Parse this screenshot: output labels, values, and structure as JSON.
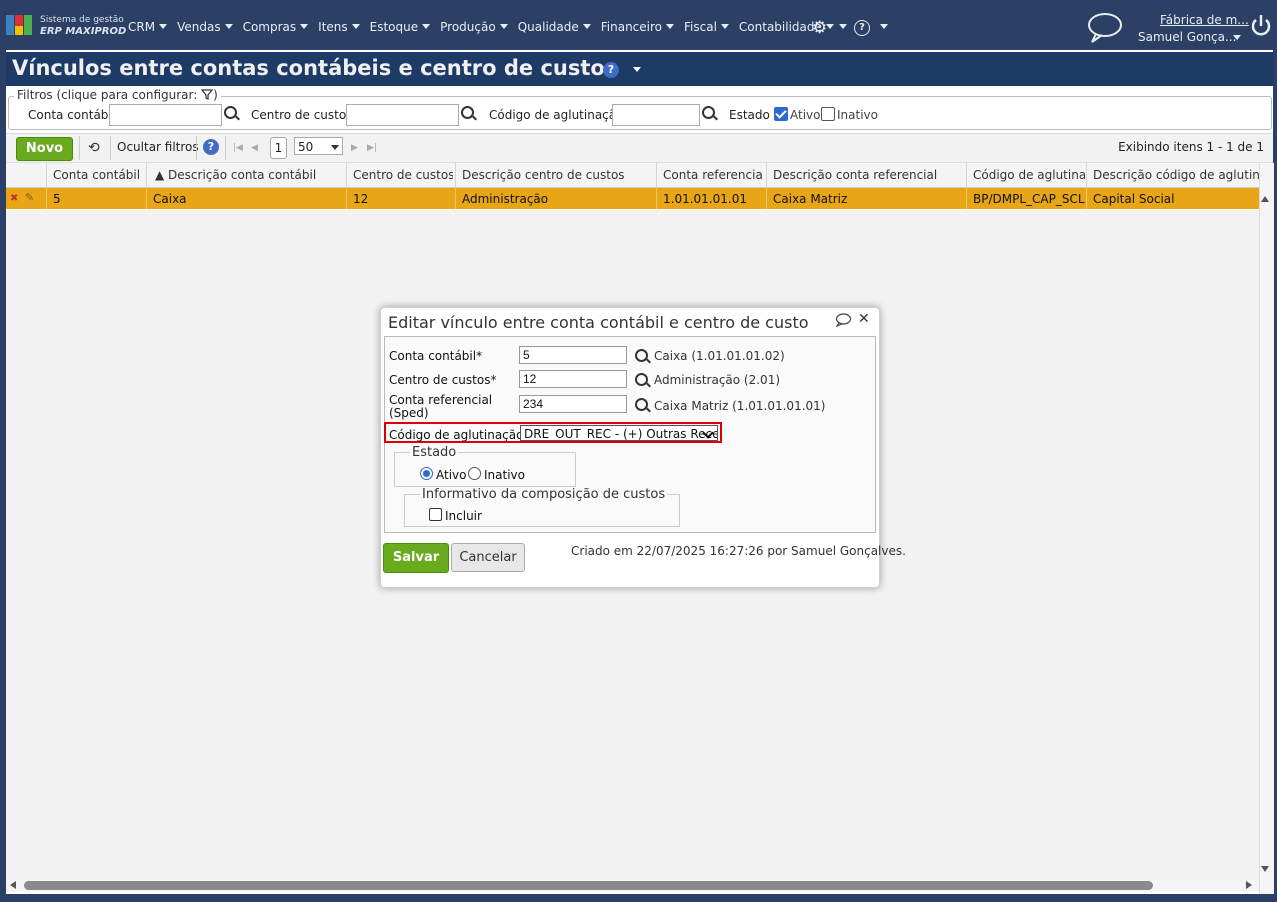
{
  "brand": {
    "line1": "Sistema de gestão",
    "line2": "ERP MAXIPROD"
  },
  "menu": [
    "CRM",
    "Vendas",
    "Compras",
    "Itens",
    "Estoque",
    "Produção",
    "Qualidade",
    "Financeiro",
    "Fiscal",
    "Contabilidade"
  ],
  "account": {
    "company": "Fábrica de m...",
    "user": "Samuel Gonça..."
  },
  "page_title": "Vínculos entre contas contábeis e centro de custos",
  "filters": {
    "legend": "Filtros (clique para configurar:",
    "legend_end": ")",
    "conta_label": "Conta contábil",
    "conta_value": "",
    "centro_label": "Centro de custos",
    "centro_value": "",
    "codigo_label": "Código de aglutinação",
    "codigo_value": "",
    "estado_label": "Estado",
    "ativo_label": "Ativo",
    "ativo_checked": true,
    "inativo_label": "Inativo",
    "inativo_checked": false
  },
  "toolbar": {
    "new_label": "Novo",
    "hide_filters_label": "Ocultar filtros",
    "page": "1",
    "page_size": "50",
    "showing": "Exibindo itens 1 - 1 de 1"
  },
  "grid": {
    "columns": [
      "Conta contábil",
      "▲ Descrição conta contábil",
      "Centro de custos",
      "Descrição centro de custos",
      "Conta referencial",
      "Descrição conta referencial",
      "Código de aglutinação",
      "Descrição código de aglutinação"
    ],
    "rows": [
      [
        "5",
        "Caixa",
        "12",
        "Administração",
        "1.01.01.01.01",
        "Caixa Matriz",
        "BP/DMPL_CAP_SCL",
        "Capital Social"
      ]
    ]
  },
  "dialog": {
    "title": "Editar vínculo entre conta contábil e centro de custo",
    "conta_label": "Conta contábil*",
    "conta_value": "5",
    "conta_desc": "Caixa (1.01.01.01.02)",
    "centro_label": "Centro de custos*",
    "centro_value": "12",
    "centro_desc": "Administração (2.01)",
    "ref_label_1": "Conta referencial",
    "ref_label_2": "(Sped)",
    "ref_value": "234",
    "ref_desc": "Caixa Matriz (1.01.01.01.01)",
    "codigo_label": "Código de aglutinação",
    "codigo_value": "DRE_OUT_REC - (+) Outras Rece",
    "estado_legend": "Estado",
    "ativo_label": "Ativo",
    "ativo_selected": true,
    "inativo_label": "Inativo",
    "info_legend": "Informativo da composição de custos",
    "incluir_label": "Incluir",
    "incluir_checked": false,
    "save_label": "Salvar",
    "cancel_label": "Cancelar",
    "created": "Criado em 22/07/2025 16:27:26 por Samuel Gonçalves."
  },
  "colors": {
    "menu_bg": "#2c4066",
    "title_bg": "#1e3a66",
    "selected_row": "#e8a617",
    "save_green": "#6aaa1e",
    "highlight": "#e00000"
  }
}
